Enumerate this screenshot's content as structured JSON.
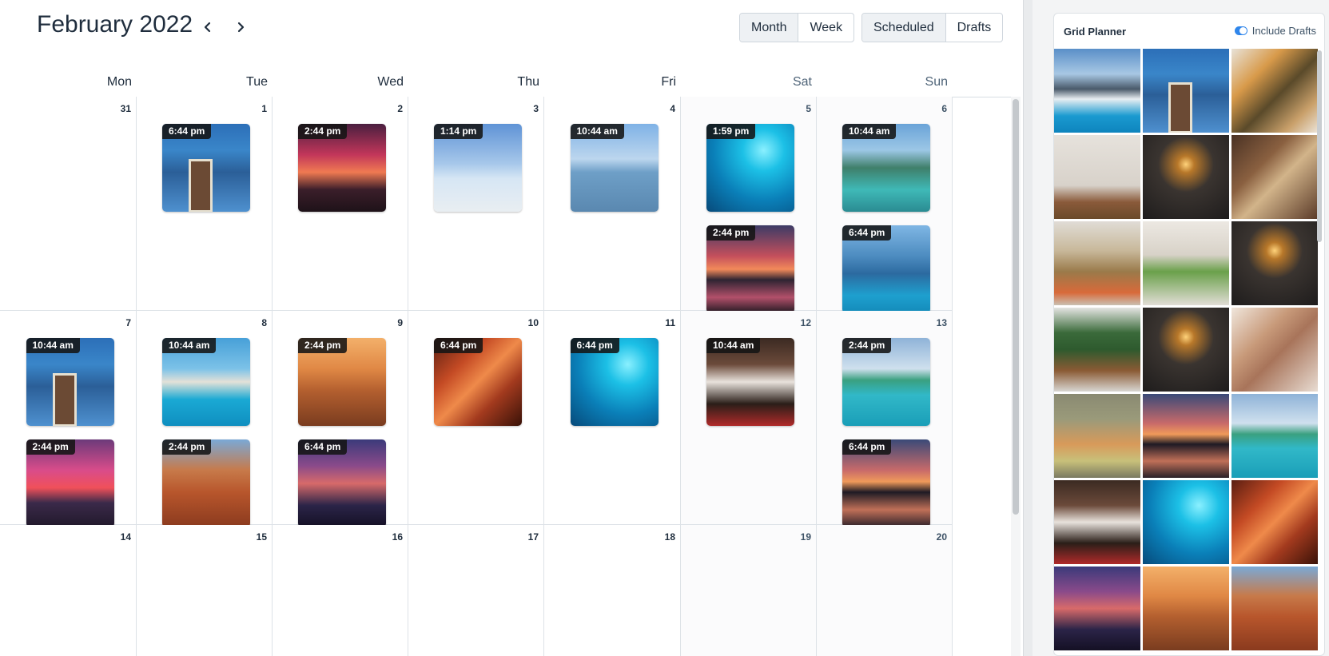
{
  "header": {
    "month_title": "February 2022",
    "prev_icon": "chevron-left-icon",
    "next_icon": "chevron-right-icon",
    "view_toggle": [
      {
        "label": "Month",
        "active": true
      },
      {
        "label": "Week",
        "active": false
      }
    ],
    "filter_toggle": [
      {
        "label": "Scheduled",
        "active": true
      },
      {
        "label": "Drafts",
        "active": false
      }
    ]
  },
  "weekdays": [
    "Mon",
    "Tue",
    "Wed",
    "Thu",
    "Fri",
    "Sat",
    "Sun"
  ],
  "weeks": [
    {
      "days": [
        {
          "num": "31",
          "posts": []
        },
        {
          "num": "1",
          "posts": [
            {
              "time": "6:44 pm",
              "image": "p-blue-house"
            }
          ]
        },
        {
          "num": "2",
          "posts": [
            {
              "time": "2:44 pm",
              "image": "p-sunset-tree"
            }
          ]
        },
        {
          "num": "3",
          "posts": [
            {
              "time": "1:14 pm",
              "image": "p-salt-flat"
            }
          ]
        },
        {
          "num": "4",
          "posts": [
            {
              "time": "10:44 am",
              "image": "p-beach-girl"
            }
          ]
        },
        {
          "num": "5",
          "posts": [
            {
              "time": "1:59 pm",
              "image": "p-diver"
            },
            {
              "time": "2:44 pm",
              "image": "p-rock-sunset"
            }
          ]
        },
        {
          "num": "6",
          "posts": [
            {
              "time": "10:44 am",
              "image": "p-cove"
            },
            {
              "time": "6:44 pm",
              "image": "p-infinity"
            }
          ]
        }
      ]
    },
    {
      "days": [
        {
          "num": "7",
          "posts": [
            {
              "time": "10:44 am",
              "image": "p-blue-house"
            },
            {
              "time": "2:44 pm",
              "image": "p-pink-sunset"
            }
          ]
        },
        {
          "num": "8",
          "posts": [
            {
              "time": "10:44 am",
              "image": "p-pool-house"
            },
            {
              "time": "2:44 pm",
              "image": "p-red-rocks"
            }
          ]
        },
        {
          "num": "9",
          "posts": [
            {
              "time": "2:44 pm",
              "image": "p-desert"
            },
            {
              "time": "6:44 pm",
              "image": "p-city"
            }
          ]
        },
        {
          "num": "10",
          "posts": [
            {
              "time": "6:44 pm",
              "image": "p-canyon"
            }
          ]
        },
        {
          "num": "11",
          "posts": [
            {
              "time": "6:44 pm",
              "image": "p-diver"
            }
          ]
        },
        {
          "num": "12",
          "posts": [
            {
              "time": "10:44 am",
              "image": "p-bartender"
            }
          ]
        },
        {
          "num": "13",
          "posts": [
            {
              "time": "2:44 pm",
              "image": "p-island"
            },
            {
              "time": "6:44 pm",
              "image": "p-lake-sunset"
            }
          ]
        }
      ]
    },
    {
      "days": [
        {
          "num": "14",
          "posts": []
        },
        {
          "num": "15",
          "posts": []
        },
        {
          "num": "16",
          "posts": []
        },
        {
          "num": "17",
          "posts": []
        },
        {
          "num": "18",
          "posts": []
        },
        {
          "num": "19",
          "posts": []
        },
        {
          "num": "20",
          "posts": []
        }
      ]
    }
  ],
  "grid_planner": {
    "title": "Grid Planner",
    "toggle_label": "Include Drafts",
    "toggle_on": true,
    "toggle_color": "#2f86eb",
    "tiles": [
      "p-coast",
      "p-blue-house",
      "p-food",
      "p-vase",
      "p-bulb",
      "p-pastry",
      "p-jars",
      "p-bag",
      "p-bulb",
      "p-plant",
      "p-bulb",
      "p-paper",
      "p-fruit",
      "p-lake-sunset",
      "p-island",
      "p-bartender",
      "p-diver",
      "p-canyon",
      "p-city",
      "p-desert",
      "p-red-rocks"
    ]
  }
}
